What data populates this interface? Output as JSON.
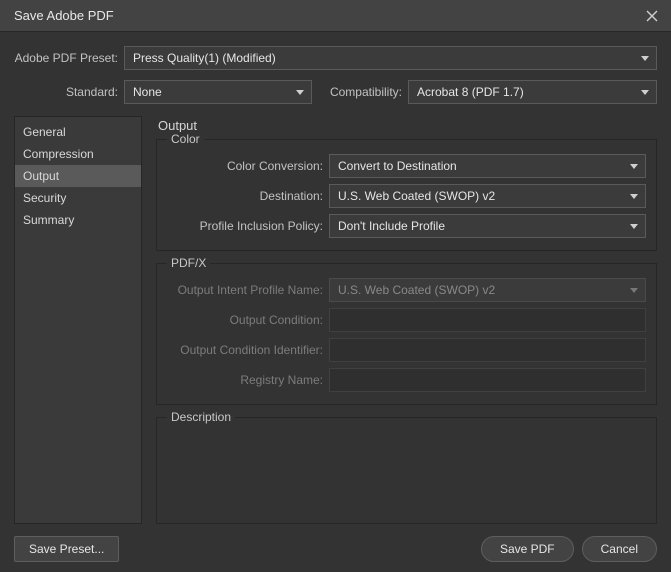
{
  "window": {
    "title": "Save Adobe PDF"
  },
  "top": {
    "preset_label": "Adobe PDF Preset:",
    "preset_value": "Press Quality(1) (Modified)",
    "standard_label": "Standard:",
    "standard_value": "None",
    "compat_label": "Compatibility:",
    "compat_value": "Acrobat 8 (PDF 1.7)"
  },
  "sidebar": {
    "items": [
      {
        "label": "General",
        "selected": false
      },
      {
        "label": "Compression",
        "selected": false
      },
      {
        "label": "Output",
        "selected": true
      },
      {
        "label": "Security",
        "selected": false
      },
      {
        "label": "Summary",
        "selected": false
      }
    ]
  },
  "panel": {
    "title": "Output",
    "color": {
      "legend": "Color",
      "conversion_label": "Color Conversion:",
      "conversion_value": "Convert to Destination",
      "destination_label": "Destination:",
      "destination_value": "U.S. Web Coated (SWOP) v2",
      "policy_label": "Profile Inclusion Policy:",
      "policy_value": "Don't Include Profile"
    },
    "pdfx": {
      "legend": "PDF/X",
      "intent_label": "Output Intent Profile Name:",
      "intent_value": "U.S. Web Coated (SWOP) v2",
      "condition_label": "Output Condition:",
      "condition_value": "",
      "condition_id_label": "Output Condition Identifier:",
      "condition_id_value": "",
      "registry_label": "Registry Name:",
      "registry_value": ""
    },
    "description": {
      "legend": "Description"
    }
  },
  "footer": {
    "save_preset": "Save Preset...",
    "save_pdf": "Save PDF",
    "cancel": "Cancel"
  }
}
